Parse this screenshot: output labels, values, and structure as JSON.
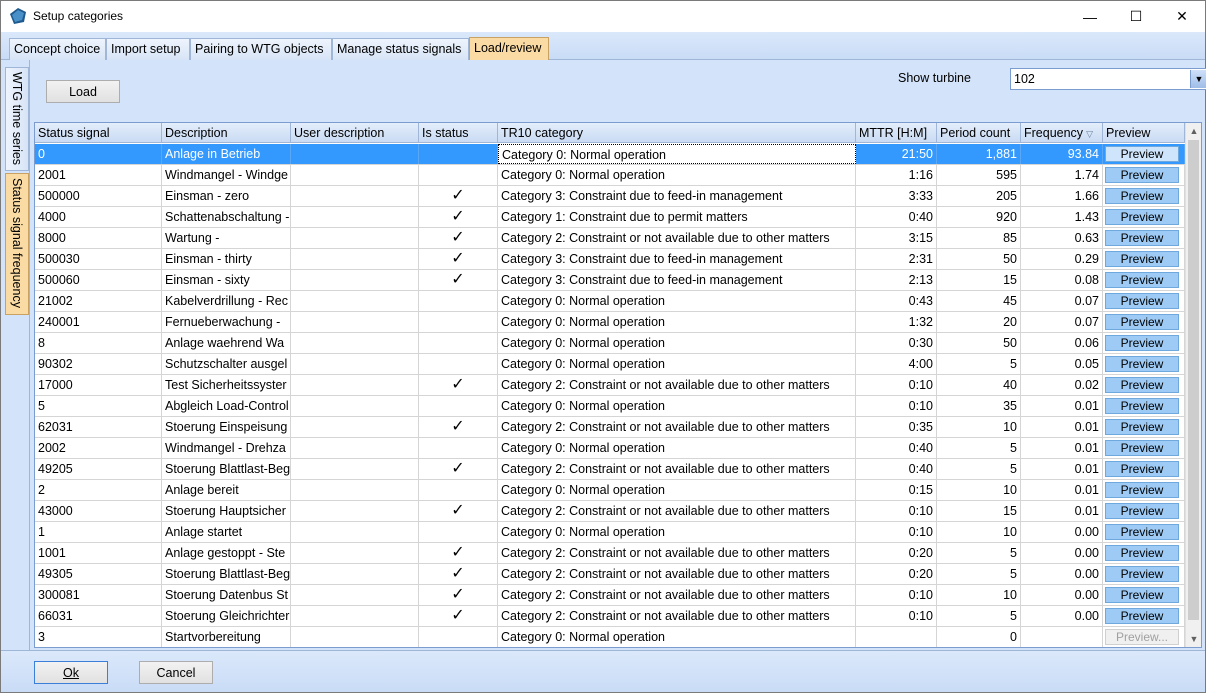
{
  "window": {
    "title": "Setup categories",
    "controls": {
      "minimize": "—",
      "maximize": "☐",
      "close": "✕"
    }
  },
  "tabs": [
    {
      "label": "Concept choice",
      "active": false
    },
    {
      "label": "Import setup",
      "active": false
    },
    {
      "label": "Pairing to WTG objects",
      "active": false
    },
    {
      "label": "Manage status signals",
      "active": false
    },
    {
      "label": "Load/review",
      "active": true
    }
  ],
  "side_tabs": [
    {
      "label": "WTG time series",
      "active": false
    },
    {
      "label": "Status signal frequency",
      "active": true
    }
  ],
  "toolbar": {
    "load_label": "Load",
    "show_turbine_label": "Show turbine",
    "turbine_value": "102"
  },
  "grid": {
    "columns": [
      "Status signal",
      "Description",
      "User description",
      "Is status",
      "TR10 category",
      "MTTR [H:M]",
      "Period count",
      "Frequency",
      "Preview"
    ],
    "sort_column": "Frequency",
    "rows": [
      {
        "signal": "0",
        "desc": "Anlage in Betrieb",
        "user": "",
        "is_status": false,
        "cat": "Category 0: Normal operation",
        "mttr": "21:50",
        "count": "1,881",
        "freq": "93.84",
        "preview": "Preview",
        "selected": true
      },
      {
        "signal": "2001",
        "desc": "Windmangel - Windge",
        "user": "",
        "is_status": false,
        "cat": "Category 0: Normal operation",
        "mttr": "1:16",
        "count": "595",
        "freq": "1.74",
        "preview": "Preview"
      },
      {
        "signal": "500000",
        "desc": "Einsman - zero",
        "user": "",
        "is_status": true,
        "cat": "Category 3: Constraint due to feed-in management",
        "mttr": "3:33",
        "count": "205",
        "freq": "1.66",
        "preview": "Preview"
      },
      {
        "signal": "4000",
        "desc": "Schattenabschaltung -",
        "user": "",
        "is_status": true,
        "cat": "Category 1: Constraint due to permit matters",
        "mttr": "0:40",
        "count": "920",
        "freq": "1.43",
        "preview": "Preview"
      },
      {
        "signal": "8000",
        "desc": "Wartung -",
        "user": "",
        "is_status": true,
        "cat": "Category 2: Constraint or not available due to other matters",
        "mttr": "3:15",
        "count": "85",
        "freq": "0.63",
        "preview": "Preview"
      },
      {
        "signal": "500030",
        "desc": "Einsman - thirty",
        "user": "",
        "is_status": true,
        "cat": "Category 3: Constraint due to feed-in management",
        "mttr": "2:31",
        "count": "50",
        "freq": "0.29",
        "preview": "Preview"
      },
      {
        "signal": "500060",
        "desc": "Einsman - sixty",
        "user": "",
        "is_status": true,
        "cat": "Category 3: Constraint due to feed-in management",
        "mttr": "2:13",
        "count": "15",
        "freq": "0.08",
        "preview": "Preview"
      },
      {
        "signal": "21002",
        "desc": "Kabelverdrillung - Rec",
        "user": "",
        "is_status": false,
        "cat": "Category 0: Normal operation",
        "mttr": "0:43",
        "count": "45",
        "freq": "0.07",
        "preview": "Preview"
      },
      {
        "signal": "240001",
        "desc": "Fernueberwachung -",
        "user": "",
        "is_status": false,
        "cat": "Category 0: Normal operation",
        "mttr": "1:32",
        "count": "20",
        "freq": "0.07",
        "preview": "Preview"
      },
      {
        "signal": "8",
        "desc": "Anlage waehrend Wa",
        "user": "",
        "is_status": false,
        "cat": "Category 0: Normal operation",
        "mttr": "0:30",
        "count": "50",
        "freq": "0.06",
        "preview": "Preview"
      },
      {
        "signal": "90302",
        "desc": "Schutzschalter ausgel",
        "user": "",
        "is_status": false,
        "cat": "Category 0: Normal operation",
        "mttr": "4:00",
        "count": "5",
        "freq": "0.05",
        "preview": "Preview"
      },
      {
        "signal": "17000",
        "desc": "Test Sicherheitssyster",
        "user": "",
        "is_status": true,
        "cat": "Category 2: Constraint or not available due to other matters",
        "mttr": "0:10",
        "count": "40",
        "freq": "0.02",
        "preview": "Preview"
      },
      {
        "signal": "5",
        "desc": "Abgleich Load-Control",
        "user": "",
        "is_status": false,
        "cat": "Category 0: Normal operation",
        "mttr": "0:10",
        "count": "35",
        "freq": "0.01",
        "preview": "Preview"
      },
      {
        "signal": "62031",
        "desc": "Stoerung Einspeisung",
        "user": "",
        "is_status": true,
        "cat": "Category 2: Constraint or not available due to other matters",
        "mttr": "0:35",
        "count": "10",
        "freq": "0.01",
        "preview": "Preview"
      },
      {
        "signal": "2002",
        "desc": "Windmangel - Drehza",
        "user": "",
        "is_status": false,
        "cat": "Category 0: Normal operation",
        "mttr": "0:40",
        "count": "5",
        "freq": "0.01",
        "preview": "Preview"
      },
      {
        "signal": "49205",
        "desc": "Stoerung Blattlast-Beg",
        "user": "",
        "is_status": true,
        "cat": "Category 2: Constraint or not available due to other matters",
        "mttr": "0:40",
        "count": "5",
        "freq": "0.01",
        "preview": "Preview"
      },
      {
        "signal": "2",
        "desc": "Anlage bereit",
        "user": "",
        "is_status": false,
        "cat": "Category 0: Normal operation",
        "mttr": "0:15",
        "count": "10",
        "freq": "0.01",
        "preview": "Preview"
      },
      {
        "signal": "43000",
        "desc": "Stoerung Hauptsicher",
        "user": "",
        "is_status": true,
        "cat": "Category 2: Constraint or not available due to other matters",
        "mttr": "0:10",
        "count": "15",
        "freq": "0.01",
        "preview": "Preview"
      },
      {
        "signal": "1",
        "desc": "Anlage startet",
        "user": "",
        "is_status": false,
        "cat": "Category 0: Normal operation",
        "mttr": "0:10",
        "count": "10",
        "freq": "0.00",
        "preview": "Preview"
      },
      {
        "signal": "1001",
        "desc": "Anlage gestoppt - Ste",
        "user": "",
        "is_status": true,
        "cat": "Category 2: Constraint or not available due to other matters",
        "mttr": "0:20",
        "count": "5",
        "freq": "0.00",
        "preview": "Preview"
      },
      {
        "signal": "49305",
        "desc": "Stoerung Blattlast-Beg",
        "user": "",
        "is_status": true,
        "cat": "Category 2: Constraint or not available due to other matters",
        "mttr": "0:20",
        "count": "5",
        "freq": "0.00",
        "preview": "Preview"
      },
      {
        "signal": "300081",
        "desc": "Stoerung Datenbus St",
        "user": "",
        "is_status": true,
        "cat": "Category 2: Constraint or not available due to other matters",
        "mttr": "0:10",
        "count": "10",
        "freq": "0.00",
        "preview": "Preview"
      },
      {
        "signal": "66031",
        "desc": "Stoerung Gleichrichter",
        "user": "",
        "is_status": true,
        "cat": "Category 2: Constraint or not available due to other matters",
        "mttr": "0:10",
        "count": "5",
        "freq": "0.00",
        "preview": "Preview"
      },
      {
        "signal": "3",
        "desc": "Startvorbereitung",
        "user": "",
        "is_status": false,
        "cat": "Category 0: Normal operation",
        "mttr": "",
        "count": "0",
        "freq": "",
        "preview": "Preview...",
        "disabled": true
      }
    ]
  },
  "footer": {
    "ok_label": "Ok",
    "cancel_label": "Cancel"
  },
  "colors": {
    "selected_row": "#3399ff",
    "active_tab": "#fbdba4",
    "panel_bg": "#d3e3f9",
    "preview_button": "#9ecbf5"
  }
}
